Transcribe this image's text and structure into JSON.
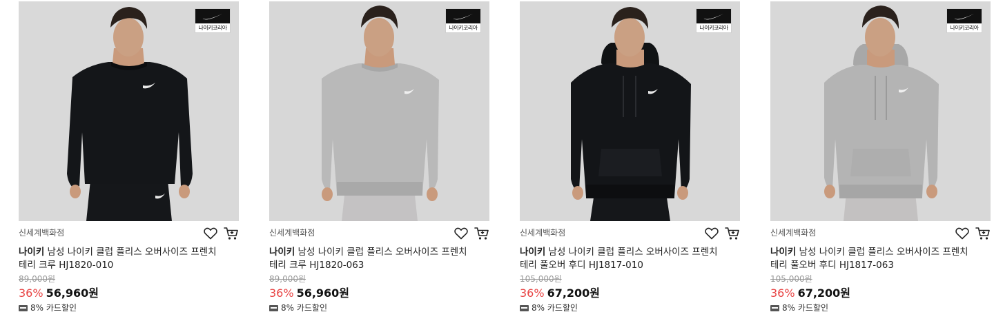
{
  "colors": {
    "discount": "#e84343",
    "badge_bg": "#111111",
    "original_price": "#999999"
  },
  "products": [
    {
      "brand_badge_text": "나이키코리아",
      "garment_color": "#141619",
      "pants_color": "#15171a",
      "store": "신세계백화점",
      "brand": "나이키",
      "title_rest": " 남성 나이키 클럽 플리스 오버사이즈 프렌치",
      "title_line2": "테리 크루 HJ1820-010",
      "original_price": "89,000원",
      "discount": "36%",
      "sale_price": "56,960원",
      "card_discount": "8% 카드할인",
      "wishlist_icon": "heart-icon",
      "cart_icon": "cart-icon"
    },
    {
      "brand_badge_text": "나이키코리아",
      "garment_color": "#b9b9b9",
      "pants_color": "#c4c2c3",
      "store": "신세계백화점",
      "brand": "나이키",
      "title_rest": " 남성 나이키 클럽 플리스 오버사이즈 프렌치",
      "title_line2": "테리 크루 HJ1820-063",
      "original_price": "89,000원",
      "discount": "36%",
      "sale_price": "56,960원",
      "card_discount": "8% 카드할인",
      "wishlist_icon": "heart-icon",
      "cart_icon": "cart-icon"
    },
    {
      "brand_badge_text": "나이키코리아",
      "garment_color": "#131518",
      "pants_color": "#15171a",
      "store": "신세계백화점",
      "brand": "나이키",
      "title_rest": " 남성 나이키 클럽 플리스 오버사이즈 프렌치",
      "title_line2": "테리 풀오버 후디 HJ1817-010",
      "original_price": "105,000원",
      "discount": "36%",
      "sale_price": "67,200원",
      "card_discount": "8% 카드할인",
      "wishlist_icon": "heart-icon",
      "cart_icon": "cart-icon"
    },
    {
      "brand_badge_text": "나이키코리아",
      "garment_color": "#b4b4b4",
      "pants_color": "#c3c1c1",
      "store": "신세계백화점",
      "brand": "나이키",
      "title_rest": " 남성 나이키 클럽 플리스 오버사이즈 프렌치",
      "title_line2": "테리 풀오버 후디 HJ1817-063",
      "original_price": "105,000원",
      "discount": "36%",
      "sale_price": "67,200원",
      "card_discount": "8% 카드할인",
      "wishlist_icon": "heart-icon",
      "cart_icon": "cart-icon"
    }
  ]
}
